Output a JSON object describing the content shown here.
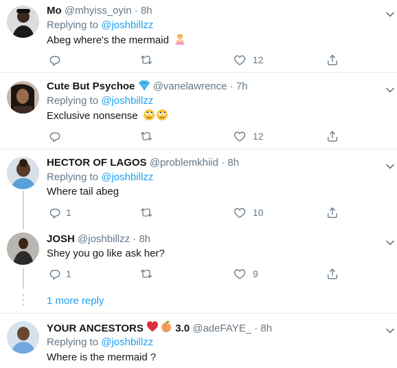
{
  "tweets": [
    {
      "name": "Mo",
      "handle": "@mhyiss_oyin",
      "sep": "·",
      "time": "8h",
      "replying_prefix": "Replying to ",
      "replying_to": "@joshbillzz",
      "text": "Abeg where's the mermaid",
      "text_emoji": "person-gesturing-no-emoji",
      "reply_count": "",
      "like_count": "12"
    },
    {
      "name": "Cute But Psychoe",
      "badge": "gem-emoji",
      "handle": "@vanelawrence",
      "sep": "·",
      "time": "7h",
      "replying_prefix": "Replying to ",
      "replying_to": "@joshbillzz",
      "text": "Exclusive nonsense",
      "text_emoji": "face-with-rolling-eyes-emoji x2",
      "reply_count": "",
      "like_count": "12"
    },
    {
      "name": "HECTOR OF LAGOS",
      "handle": "@problemkhiid",
      "sep": "·",
      "time": "8h",
      "replying_prefix": "Replying to ",
      "replying_to": "@joshbillzz",
      "text": "Where tail abeg",
      "reply_count": "1",
      "like_count": "10"
    },
    {
      "name": "JOSH",
      "handle": "@joshbillzz",
      "sep": "·",
      "time": "8h",
      "text": "Shey you go like ask her?",
      "reply_count": "1",
      "like_count": "9"
    },
    {
      "name": "YOUR ANCESTORS",
      "name_suffix": "3.0",
      "badge": "heart-and-peach-emoji",
      "handle": "@adeFAYE_",
      "sep": "·",
      "time": "8h",
      "replying_prefix": "Replying to ",
      "replying_to": "@joshbillzz",
      "text": "Where is the mermaid ?"
    }
  ],
  "more_replies": "1 more reply",
  "colors": {
    "text": "#14171a",
    "secondary": "#657786",
    "link": "#1da1f2",
    "divider": "#e6ecf0",
    "thread_line": "#ccd6dd"
  }
}
